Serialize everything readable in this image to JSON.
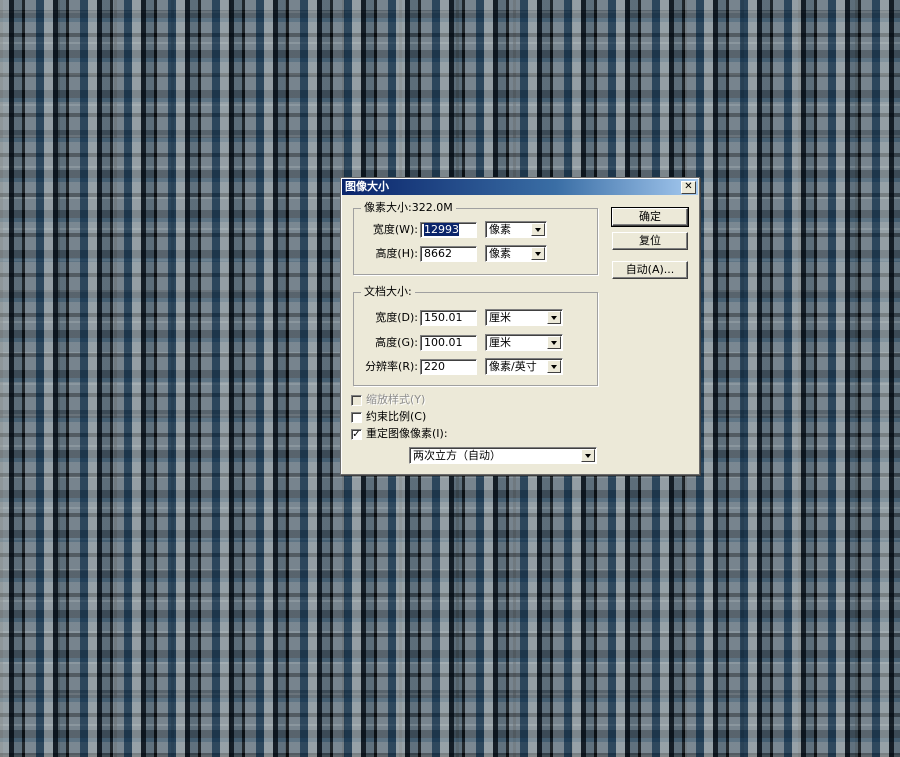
{
  "dialog": {
    "title": "图像大小",
    "close_glyph": "✕"
  },
  "pixel_dimensions": {
    "legend": "像素大小:322.0M",
    "width_label": "宽度(W):",
    "width_value": "12993",
    "width_unit": "像素",
    "height_label": "高度(H):",
    "height_value": "8662",
    "height_unit": "像素"
  },
  "document_size": {
    "legend": "文档大小:",
    "width_label": "宽度(D):",
    "width_value": "150.01",
    "width_unit": "厘米",
    "height_label": "高度(G):",
    "height_value": "100.01",
    "height_unit": "厘米",
    "resolution_label": "分辨率(R):",
    "resolution_value": "220",
    "resolution_unit": "像素/英寸"
  },
  "options": {
    "scale_styles_label": "缩放样式(Y)",
    "scale_styles_checked": false,
    "scale_styles_enabled": false,
    "constrain_label": "约束比例(C)",
    "constrain_checked": false,
    "resample_label": "重定图像像素(I):",
    "resample_checked": true,
    "check_glyph": "✓",
    "resample_method": "两次立方（自动）"
  },
  "buttons": {
    "ok": "确定",
    "reset": "复位",
    "auto": "自动(A)..."
  }
}
